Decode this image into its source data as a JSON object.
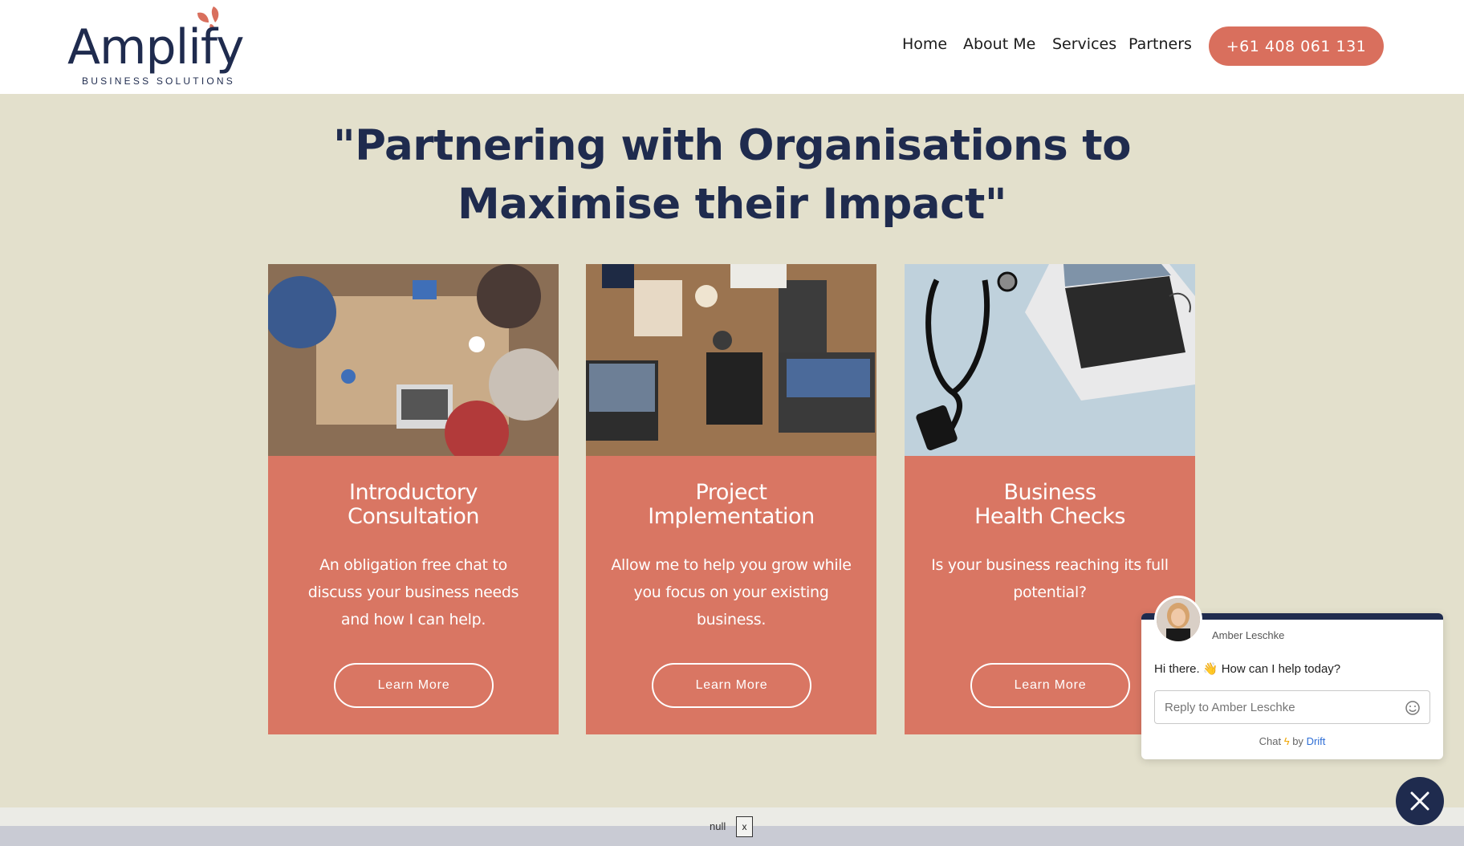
{
  "header": {
    "logo_word": "Amplify",
    "logo_sub": "BUSINESS SOLUTIONS",
    "nav": [
      "Home",
      "About Me",
      "Services",
      "Partners"
    ],
    "phone": "+61 408 061 131"
  },
  "hero": {
    "headline": "\"Partnering with Organisations to Maximise their Impact\""
  },
  "cards": [
    {
      "title": "Introductory\nConsultation",
      "text": "An obligation free chat to discuss your business needs and how I can help.",
      "button": "Learn More"
    },
    {
      "title": "Project\nImplementation",
      "text": "Allow me to help you grow while you focus on your existing business.",
      "button": "Learn More"
    },
    {
      "title": "Business\nHealth Checks",
      "text": "Is your business reaching its full potential?",
      "button": "Learn More"
    }
  ],
  "chat": {
    "agent_name": "Amber Leschke",
    "message": "Hi there. 👋 How can I help today?",
    "input_placeholder": "Reply to Amber Leschke",
    "footer_chat": "Chat",
    "footer_by": "by",
    "footer_brand": "Drift"
  },
  "debug_bar": {
    "text": "null",
    "close": "x"
  },
  "colors": {
    "navy": "#1f2b4e",
    "coral": "#d97663",
    "beige": "#e3e0cc"
  }
}
